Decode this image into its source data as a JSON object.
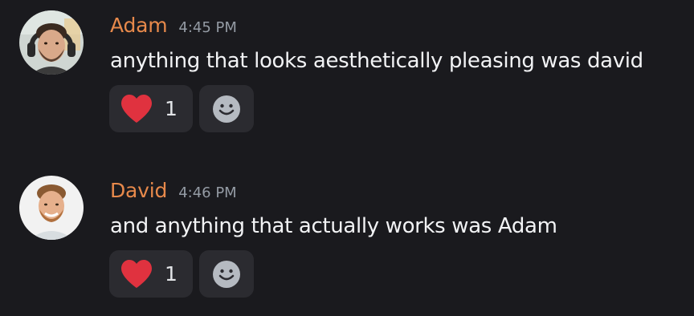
{
  "messages": [
    {
      "username": "Adam",
      "timestamp": "4:45 PM",
      "content": "anything that looks aesthetically pleasing was david",
      "reactions": [
        {
          "icon": "heart-icon",
          "count": "1"
        }
      ],
      "add_reaction_icon": "smiley-face-icon"
    },
    {
      "username": "David",
      "timestamp": "4:46 PM",
      "content": "and anything that actually works was Adam",
      "reactions": [
        {
          "icon": "heart-icon",
          "count": "1"
        }
      ],
      "add_reaction_icon": "smiley-face-icon"
    }
  ],
  "colors": {
    "background": "#1a1a1e",
    "username": "#e7894b",
    "timestamp": "#949ba4",
    "message_text": "#f2f3f5",
    "reaction_background": "#2b2b30",
    "heart": "#e0323f"
  }
}
